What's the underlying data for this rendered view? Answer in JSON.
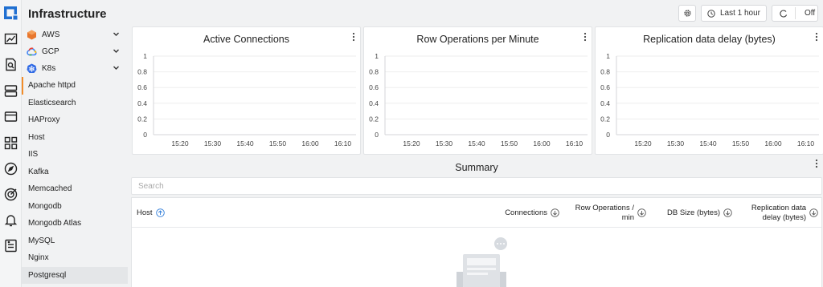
{
  "header": {
    "title": "Infrastructure",
    "time_range_label": "Last 1 hour",
    "refresh_label": "Off"
  },
  "nav": {
    "clouds": [
      {
        "label": "AWS",
        "icon": "aws-icon"
      },
      {
        "label": "GCP",
        "icon": "gcp-icon"
      },
      {
        "label": "K8s",
        "icon": "k8s-icon"
      }
    ],
    "items": [
      "Apache httpd",
      "Elasticsearch",
      "HAProxy",
      "Host",
      "IIS",
      "Kafka",
      "Memcached",
      "Mongodb",
      "Mongodb Atlas",
      "MySQL",
      "Nginx",
      "Postgresql"
    ],
    "active_item": "Postgresql",
    "marked_item": "Apache httpd"
  },
  "panels": [
    {
      "title": "Active Connections"
    },
    {
      "title": "Row Operations per Minute"
    },
    {
      "title": "Replication data delay (bytes)"
    }
  ],
  "chart_data": [
    {
      "type": "line",
      "title": "Active Connections",
      "x": [
        "15:20",
        "15:30",
        "15:40",
        "15:50",
        "16:00",
        "16:10"
      ],
      "y_ticks": [
        "1",
        "0.8",
        "0.6",
        "0.4",
        "0.2",
        "0"
      ],
      "ylim": [
        0,
        1
      ],
      "series": []
    },
    {
      "type": "line",
      "title": "Row Operations per Minute",
      "x": [
        "15:20",
        "15:30",
        "15:40",
        "15:50",
        "16:00",
        "16:10"
      ],
      "y_ticks": [
        "1",
        "0.8",
        "0.6",
        "0.4",
        "0.2",
        "0"
      ],
      "ylim": [
        0,
        1
      ],
      "series": []
    },
    {
      "type": "line",
      "title": "Replication data delay (bytes)",
      "x": [
        "15:20",
        "15:30",
        "15:40",
        "15:50",
        "16:00",
        "16:10"
      ],
      "y_ticks": [
        "1",
        "0.8",
        "0.6",
        "0.4",
        "0.2",
        "0"
      ],
      "ylim": [
        0,
        1
      ],
      "series": []
    }
  ],
  "summary": {
    "title": "Summary",
    "search_placeholder": "Search",
    "columns": {
      "host": "Host",
      "connections": "Connections",
      "row_ops_1": "Row Operations /",
      "row_ops_2": "min",
      "db_size": "DB Size (bytes)",
      "repl_1": "Replication data",
      "repl_2": "delay (bytes)"
    }
  },
  "colors": {
    "accent": "#2d7bd8",
    "marker": "#f28c28",
    "grid": "#eeeeee"
  }
}
